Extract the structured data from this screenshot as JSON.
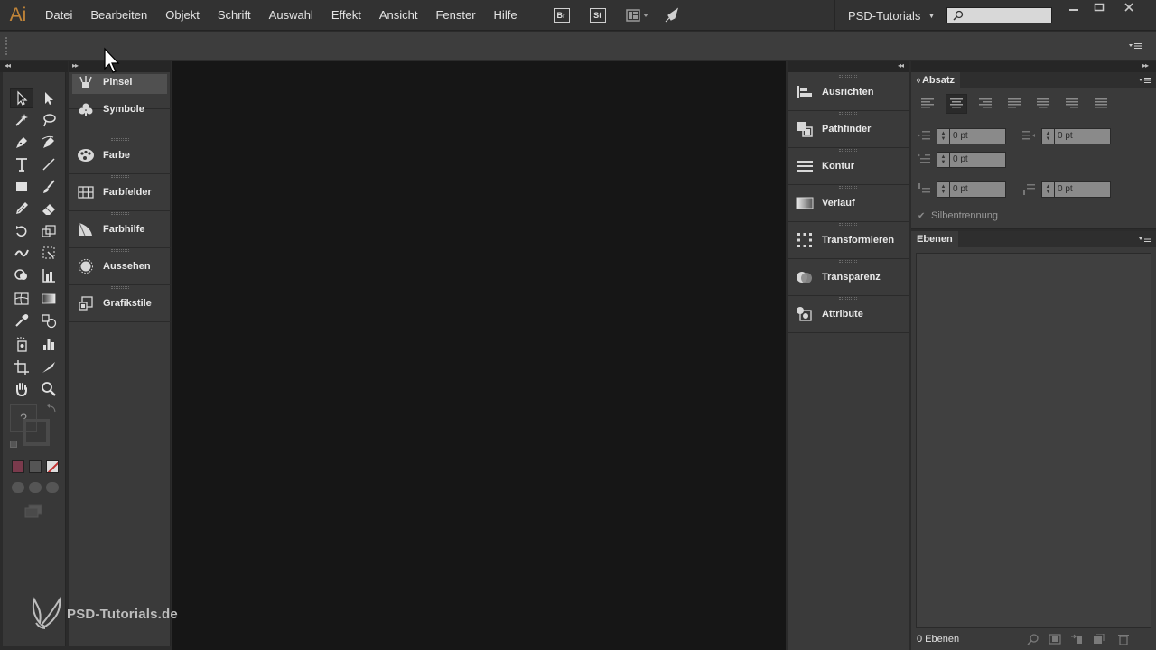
{
  "app": {
    "logo": "Ai"
  },
  "menu": [
    "Datei",
    "Bearbeiten",
    "Objekt",
    "Schrift",
    "Auswahl",
    "Effekt",
    "Ansicht",
    "Fenster",
    "Hilfe"
  ],
  "menubar_buttons": {
    "bridge": "Br",
    "stock": "St"
  },
  "workspace": {
    "label": "PSD-Tutorials"
  },
  "window_controls": [
    "minimize-icon",
    "maximize-icon",
    "close-icon"
  ],
  "left_panels": [
    {
      "label": "Pinsel",
      "icon": "brush-icon"
    },
    {
      "label": "Symbole",
      "icon": "symbols-icon"
    },
    {
      "label": "Farbe",
      "icon": "color-palette-icon"
    },
    {
      "label": "Farbfelder",
      "icon": "swatches-icon"
    },
    {
      "label": "Farbhilfe",
      "icon": "color-guide-icon"
    },
    {
      "label": "Aussehen",
      "icon": "appearance-icon"
    },
    {
      "label": "Grafikstile",
      "icon": "graphic-styles-icon"
    }
  ],
  "right_panels": [
    {
      "label": "Ausrichten",
      "icon": "align-icon"
    },
    {
      "label": "Pathfinder",
      "icon": "pathfinder-icon"
    },
    {
      "label": "Kontur",
      "icon": "stroke-icon"
    },
    {
      "label": "Verlauf",
      "icon": "gradient-icon"
    },
    {
      "label": "Transformieren",
      "icon": "transform-icon"
    },
    {
      "label": "Transparenz",
      "icon": "transparency-icon"
    },
    {
      "label": "Attribute",
      "icon": "attributes-icon"
    }
  ],
  "absatz": {
    "title": "Absatz",
    "left_indent": "0 pt",
    "right_indent": "0 pt",
    "first_line_indent": "0 pt",
    "space_before": "0 pt",
    "space_after": "0 pt",
    "hyphenation": "Silbentrennung"
  },
  "ebenen": {
    "title": "Ebenen",
    "count": "0 Ebenen"
  },
  "toolbox": {
    "question_mark": "?"
  },
  "watermark": "PSD-Tutorials.de",
  "colors": {
    "canvas": "#161616",
    "fill_swatch": "#7a3a4c",
    "logo": "#c08438"
  }
}
